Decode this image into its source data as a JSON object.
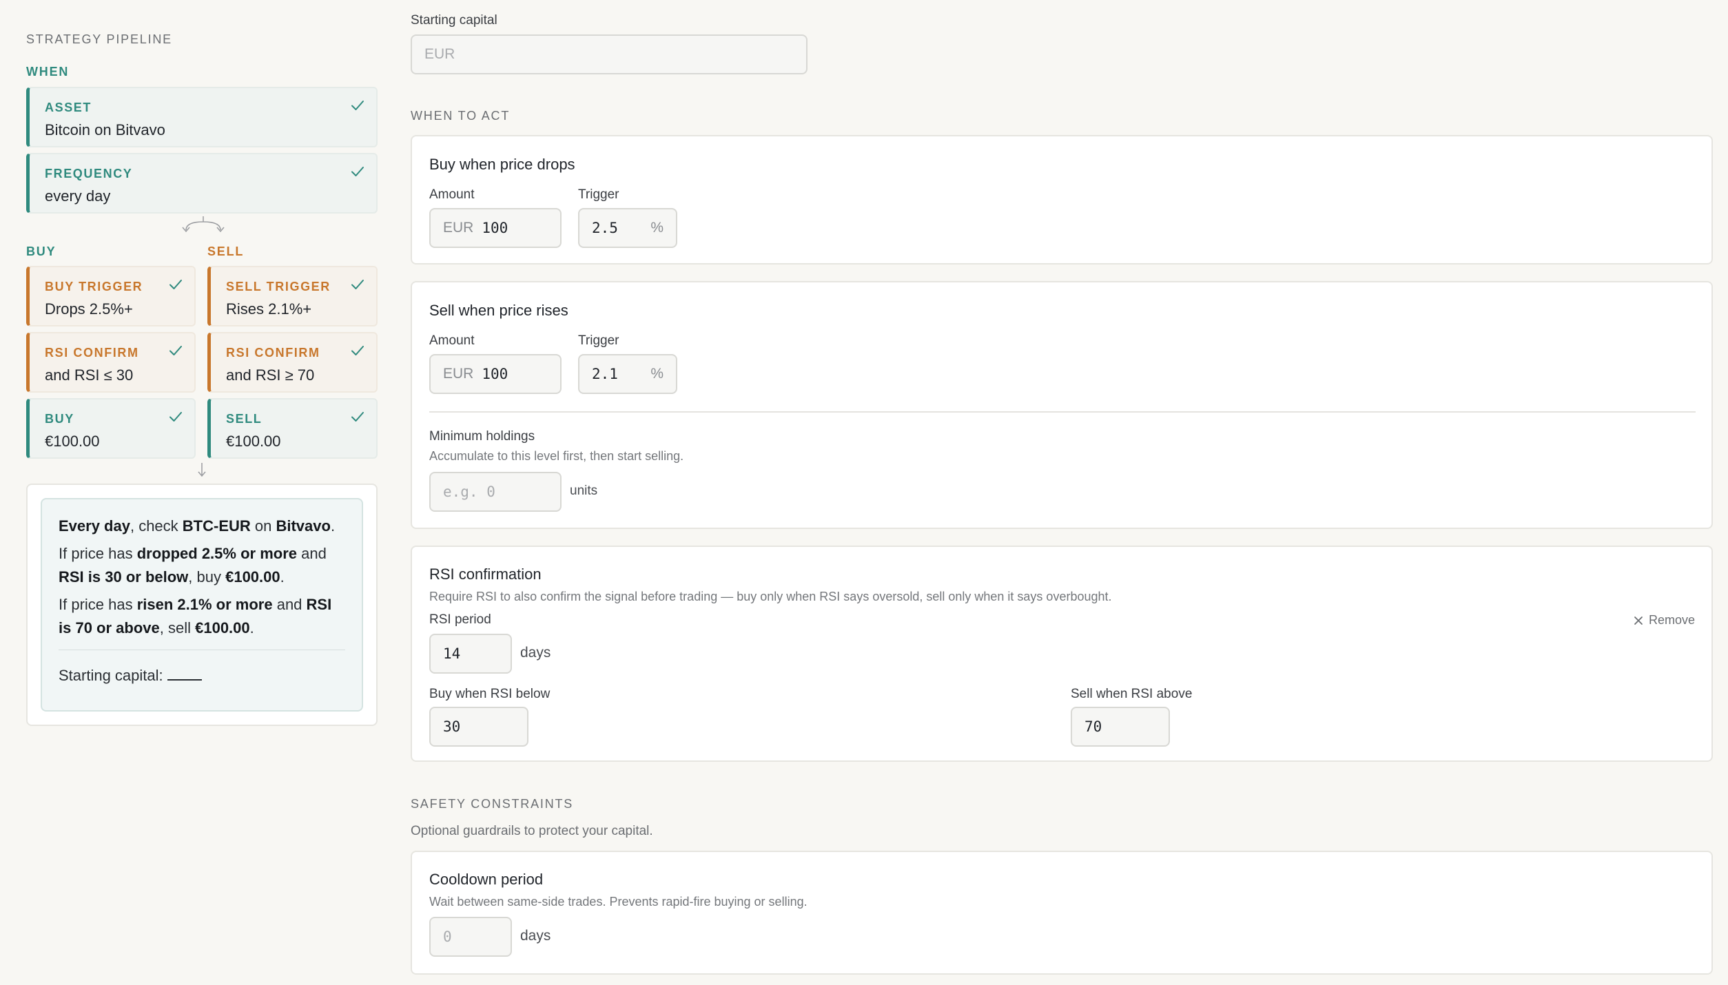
{
  "sidebar": {
    "title": "STRATEGY PIPELINE",
    "when_label": "WHEN",
    "asset": {
      "label": "ASSET",
      "value": "Bitcoin on Bitvavo"
    },
    "frequency": {
      "label": "FREQUENCY",
      "value": "every day"
    },
    "buy_label": "BUY",
    "sell_label": "SELL",
    "buy_trigger": {
      "label": "BUY TRIGGER",
      "value": "Drops 2.5%+"
    },
    "sell_trigger": {
      "label": "SELL TRIGGER",
      "value": "Rises 2.1%+"
    },
    "buy_rsi": {
      "label": "RSI CONFIRM",
      "value": "and RSI ≤ 30"
    },
    "sell_rsi": {
      "label": "RSI CONFIRM",
      "value": "and RSI ≥ 70"
    },
    "buy_action": {
      "label": "BUY",
      "value": "€100.00"
    },
    "sell_action": {
      "label": "SELL",
      "value": "€100.00"
    },
    "summary": {
      "l1_a": "Every day",
      "l1_b": ", check ",
      "l1_c": "BTC-EUR",
      "l1_d": " on ",
      "l1_e": "Bitvavo",
      "l1_f": ".",
      "l2_a": "If price has ",
      "l2_b": "dropped 2.5% or more",
      "l2_c": " and ",
      "l2_d": "RSI is 30 or below",
      "l2_e": ", buy ",
      "l2_f": "€100.00",
      "l2_g": ".",
      "l3_a": "If price has ",
      "l3_b": "risen 2.1% or more",
      "l3_c": " and ",
      "l3_d": "RSI is 70 or above",
      "l3_e": ", sell ",
      "l3_f": "€100.00",
      "l3_g": ".",
      "capital_label": "Starting capital: "
    }
  },
  "main": {
    "starting_capital": {
      "label": "Starting capital",
      "placeholder": "EUR"
    },
    "when_to_act": "WHEN TO ACT",
    "buy_panel": {
      "title": "Buy when price drops",
      "amount_label": "Amount",
      "amount_prefix": "EUR",
      "amount_value": "100",
      "trigger_label": "Trigger",
      "trigger_value": "2.5",
      "trigger_suffix": "%"
    },
    "sell_panel": {
      "title": "Sell when price rises",
      "amount_label": "Amount",
      "amount_prefix": "EUR",
      "amount_value": "100",
      "trigger_label": "Trigger",
      "trigger_value": "2.1",
      "trigger_suffix": "%",
      "min_holdings_label": "Minimum holdings",
      "min_holdings_help": "Accumulate to this level first, then start selling.",
      "min_holdings_placeholder": "e.g. 0",
      "min_holdings_unit": "units"
    },
    "rsi_panel": {
      "title": "RSI confirmation",
      "help": "Require RSI to also confirm the signal before trading — buy only when RSI says oversold, sell only when it says overbought.",
      "remove_label": "Remove",
      "period_label": "RSI period",
      "period_value": "14",
      "period_unit": "days",
      "buy_below_label": "Buy when RSI below",
      "buy_below_value": "30",
      "sell_above_label": "Sell when RSI above",
      "sell_above_value": "70"
    },
    "safety": {
      "title": "SAFETY CONSTRAINTS",
      "help": "Optional guardrails to protect your capital.",
      "cooldown_title": "Cooldown period",
      "cooldown_help": "Wait between same-side trades. Prevents rapid-fire buying or selling.",
      "cooldown_placeholder": "0",
      "cooldown_unit": "days"
    }
  },
  "colors": {
    "teal": "#2f8a7e",
    "orange": "#c8772c",
    "background": "#f8f7f3"
  },
  "icons": [
    "check-icon",
    "branch-icon",
    "arrow-down-icon",
    "close-icon"
  ]
}
